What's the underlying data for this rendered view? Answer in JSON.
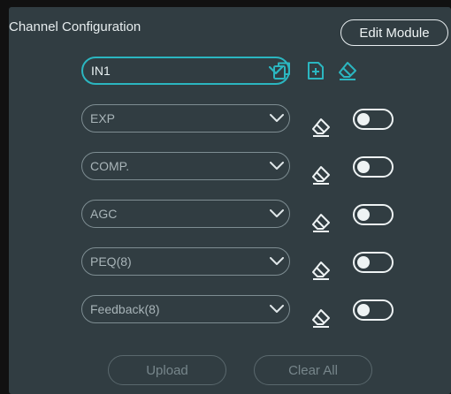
{
  "panel": {
    "title": "Channel Configuration",
    "edit_module_label": "Edit Module"
  },
  "channel_select": {
    "value": "IN1",
    "icons": [
      "copy-icon",
      "add-file-icon",
      "eraser-icon"
    ]
  },
  "modules": [
    {
      "label": "EXP",
      "enabled": false
    },
    {
      "label": "COMP.",
      "enabled": false
    },
    {
      "label": "AGC",
      "enabled": false
    },
    {
      "label": "PEQ(8)",
      "enabled": false
    },
    {
      "label": "Feedback(8)",
      "enabled": false
    }
  ],
  "footer": {
    "upload_label": "Upload",
    "clear_all_label": "Clear All"
  },
  "colors": {
    "panel_bg": "#313d42",
    "accent": "#2bb6c0",
    "text": "#e6ecee",
    "muted": "#a8b4b8"
  }
}
